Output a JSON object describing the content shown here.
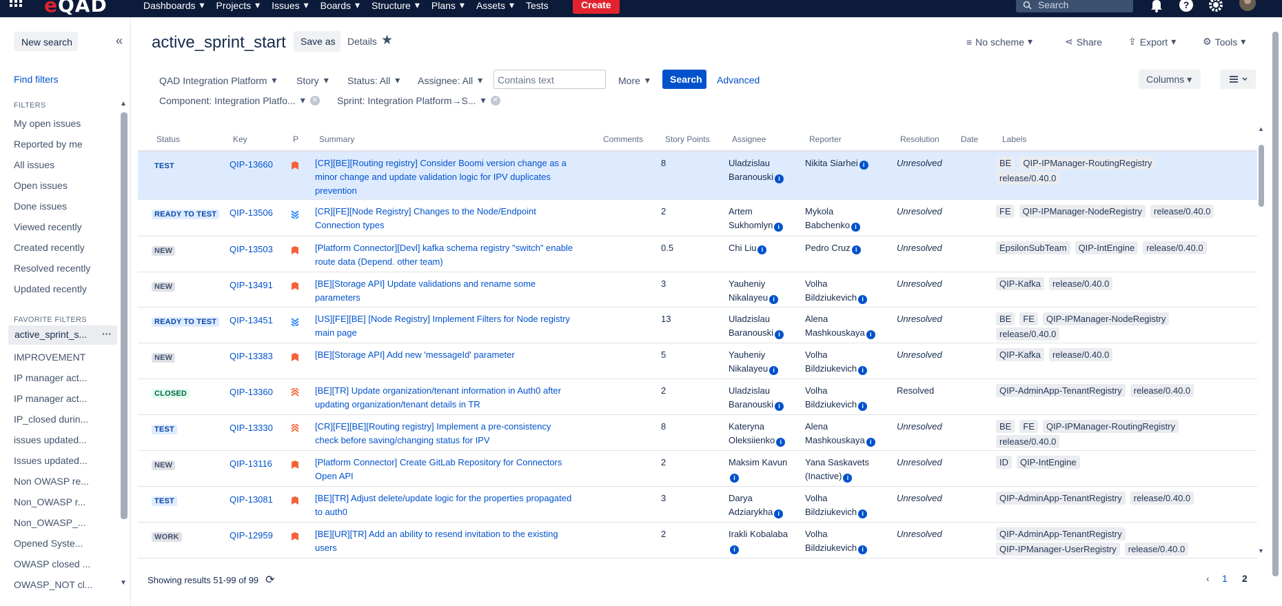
{
  "topnav": {
    "logo": "QAD",
    "menus": [
      {
        "label": "Dashboards"
      },
      {
        "label": "Projects"
      },
      {
        "label": "Issues"
      },
      {
        "label": "Boards"
      },
      {
        "label": "Structure"
      },
      {
        "label": "Plans"
      },
      {
        "label": "Assets"
      },
      {
        "label": "Tests"
      }
    ],
    "create_label": "Create",
    "search_placeholder": "Search"
  },
  "sidebar": {
    "new_search": "New search",
    "find_filters": "Find filters",
    "filters_title": "FILTERS",
    "filters": [
      "My open issues",
      "Reported by me",
      "All issues",
      "Open issues",
      "Done issues",
      "Viewed recently",
      "Created recently",
      "Resolved recently",
      "Updated recently"
    ],
    "favorites_title": "FAVORITE FILTERS",
    "favorites": [
      "active_sprint_s...",
      "IMPROVEMENT",
      "IP manager act...",
      "IP manager act...",
      "IP_closed durin...",
      "issues updated...",
      "Issues updated...",
      "Non OWASP re...",
      "Non_OWASP r...",
      "Non_OWASP_...",
      "Opened Syste...",
      "OWASP closed ...",
      "OWASP_NOT cl..."
    ]
  },
  "header": {
    "title": "active_sprint_start",
    "save_as": "Save as",
    "details": "Details",
    "no_scheme": "No scheme",
    "share": "Share",
    "export": "Export",
    "tools": "Tools"
  },
  "filterbar": {
    "project": "QAD Integration Platform",
    "type": "Story",
    "status": "Status: All",
    "assignee": "Assignee: All",
    "text_placeholder": "Contains text",
    "more": "More",
    "search": "Search",
    "advanced": "Advanced",
    "component": "Component: Integration Platfo...",
    "sprint": "Sprint: Integration Platform→S...",
    "columns": "Columns"
  },
  "table": {
    "headers": {
      "status": "Status",
      "key": "Key",
      "p": "P",
      "summary": "Summary",
      "comments": "Comments",
      "points": "Story Points",
      "assignee": "Assignee",
      "reporter": "Reporter",
      "resolution": "Resolution",
      "date": "Date",
      "labels": "Labels"
    },
    "rows": [
      {
        "status": "TEST",
        "key": "QIP-13660",
        "priority": "high",
        "summary": "[CR][BE][Routing registry] Consider Boomi version change as a minor change and update validation logic for IPV duplicates prevention",
        "points": "8",
        "assignee": [
          "Uladzislau",
          "Baranouski"
        ],
        "reporter": [
          "Nikita Siarhei"
        ],
        "resolution": "Unresolved",
        "labels": [
          "BE",
          "QIP-IPManager-RoutingRegistry",
          "release/0.40.0"
        ]
      },
      {
        "status": "READY TO TEST",
        "key": "QIP-13506",
        "priority": "lowest",
        "summary": "[CR][FE][Node Registry] Changes to the Node/Endpoint Connection types",
        "points": "2",
        "assignee": [
          "Artem",
          "Sukhomlyn"
        ],
        "reporter": [
          "Mykola",
          "Babchenko"
        ],
        "resolution": "Unresolved",
        "labels": [
          "FE",
          "QIP-IPManager-NodeRegistry",
          "release/0.40.0"
        ]
      },
      {
        "status": "NEW",
        "key": "QIP-13503",
        "priority": "high",
        "summary": "[Platform Connector][Devl] kafka schema registry \"switch\" enable route data (Depend. other team)",
        "points": "0.5",
        "assignee": [
          "Chi Liu"
        ],
        "reporter": [
          "Pedro Cruz"
        ],
        "resolution": "Unresolved",
        "labels": [
          "EpsilonSubTeam",
          "QIP-IntEngine",
          "release/0.40.0"
        ]
      },
      {
        "status": "NEW",
        "key": "QIP-13491",
        "priority": "high",
        "summary": "[BE][Storage API] Update validations and rename some parameters",
        "points": "3",
        "assignee": [
          "Yauheniy",
          "Nikalayeu"
        ],
        "reporter": [
          "Volha",
          "Bildziukevich"
        ],
        "resolution": "Unresolved",
        "labels": [
          "QIP-Kafka",
          "release/0.40.0"
        ]
      },
      {
        "status": "READY TO TEST",
        "key": "QIP-13451",
        "priority": "lowest",
        "summary": "[US][FE][BE] [Node Registry] Implement Filters for Node registry main page",
        "points": "13",
        "assignee": [
          "Uladzislau",
          "Baranouski"
        ],
        "reporter": [
          "Alena",
          "Mashkouskaya"
        ],
        "resolution": "Unresolved",
        "labels": [
          "BE",
          "FE",
          "QIP-IPManager-NodeRegistry",
          "release/0.40.0"
        ]
      },
      {
        "status": "NEW",
        "key": "QIP-13383",
        "priority": "high",
        "summary": "[BE][Storage API] Add new 'messageId' parameter",
        "points": "5",
        "assignee": [
          "Yauheniy",
          "Nikalayeu"
        ],
        "reporter": [
          "Volha",
          "Bildziukevich"
        ],
        "resolution": "Unresolved",
        "labels": [
          "QIP-Kafka",
          "release/0.40.0"
        ]
      },
      {
        "status": "CLOSED",
        "key": "QIP-13360",
        "priority": "highest",
        "summary": "[BE][TR] Update organization/tenant information in Auth0 after updating organization/tenant details in TR",
        "points": "2",
        "assignee": [
          "Uladzislau",
          "Baranouski"
        ],
        "reporter": [
          "Volha",
          "Bildziukevich"
        ],
        "resolution": "Resolved",
        "labels": [
          "QIP-AdminApp-TenantRegistry",
          "release/0.40.0"
        ]
      },
      {
        "status": "TEST",
        "key": "QIP-13330",
        "priority": "highest",
        "summary": "[CR][FE][BE][Routing registry] Implement a pre-consistency check before saving/changing status for IPV",
        "points": "8",
        "assignee": [
          "Kateryna",
          "Oleksiienko"
        ],
        "reporter": [
          "Alena",
          "Mashkouskaya"
        ],
        "resolution": "Unresolved",
        "labels": [
          "BE",
          "FE",
          "QIP-IPManager-RoutingRegistry",
          "release/0.40.0"
        ]
      },
      {
        "status": "NEW",
        "key": "QIP-13116",
        "priority": "high",
        "summary": "[Platform Connector] Create GitLab Repository for Connectors Open API",
        "points": "2",
        "assignee": [
          "Maksim Kavun",
          ""
        ],
        "reporter": [
          "Yana Saskavets",
          "(Inactive)"
        ],
        "resolution": "Unresolved",
        "labels": [
          "ID",
          "QIP-IntEngine"
        ]
      },
      {
        "status": "TEST",
        "key": "QIP-13081",
        "priority": "high",
        "summary": "[BE][TR] Adjust delete/update logic for the properties propagated to auth0",
        "points": "3",
        "assignee": [
          "Darya",
          "Adziarykha"
        ],
        "reporter": [
          "Volha",
          "Bildziukevich"
        ],
        "resolution": "Unresolved",
        "labels": [
          "QIP-AdminApp-TenantRegistry",
          "release/0.40.0"
        ]
      },
      {
        "status": "WORK",
        "key": "QIP-12959",
        "priority": "high",
        "summary": "[BE][UR][TR] Add an ability to resend invitation to the existing users",
        "points": "2",
        "assignee": [
          "Irakli Kobalaba",
          ""
        ],
        "reporter": [
          "Volha",
          "Bildziukevich"
        ],
        "resolution": "Unresolved",
        "labels": [
          "QIP-AdminApp-TenantRegistry",
          "QIP-IPManager-UserRegistry",
          "release/0.40.0"
        ]
      }
    ]
  },
  "footer": {
    "results": "Showing results 51-99 of 99",
    "pages": [
      "1",
      "2"
    ],
    "current_page": "2"
  },
  "colors": {
    "nav": "#0c1b3a",
    "brand": "#e2232e",
    "link": "#0052cc",
    "selected_row": "#deebff"
  }
}
